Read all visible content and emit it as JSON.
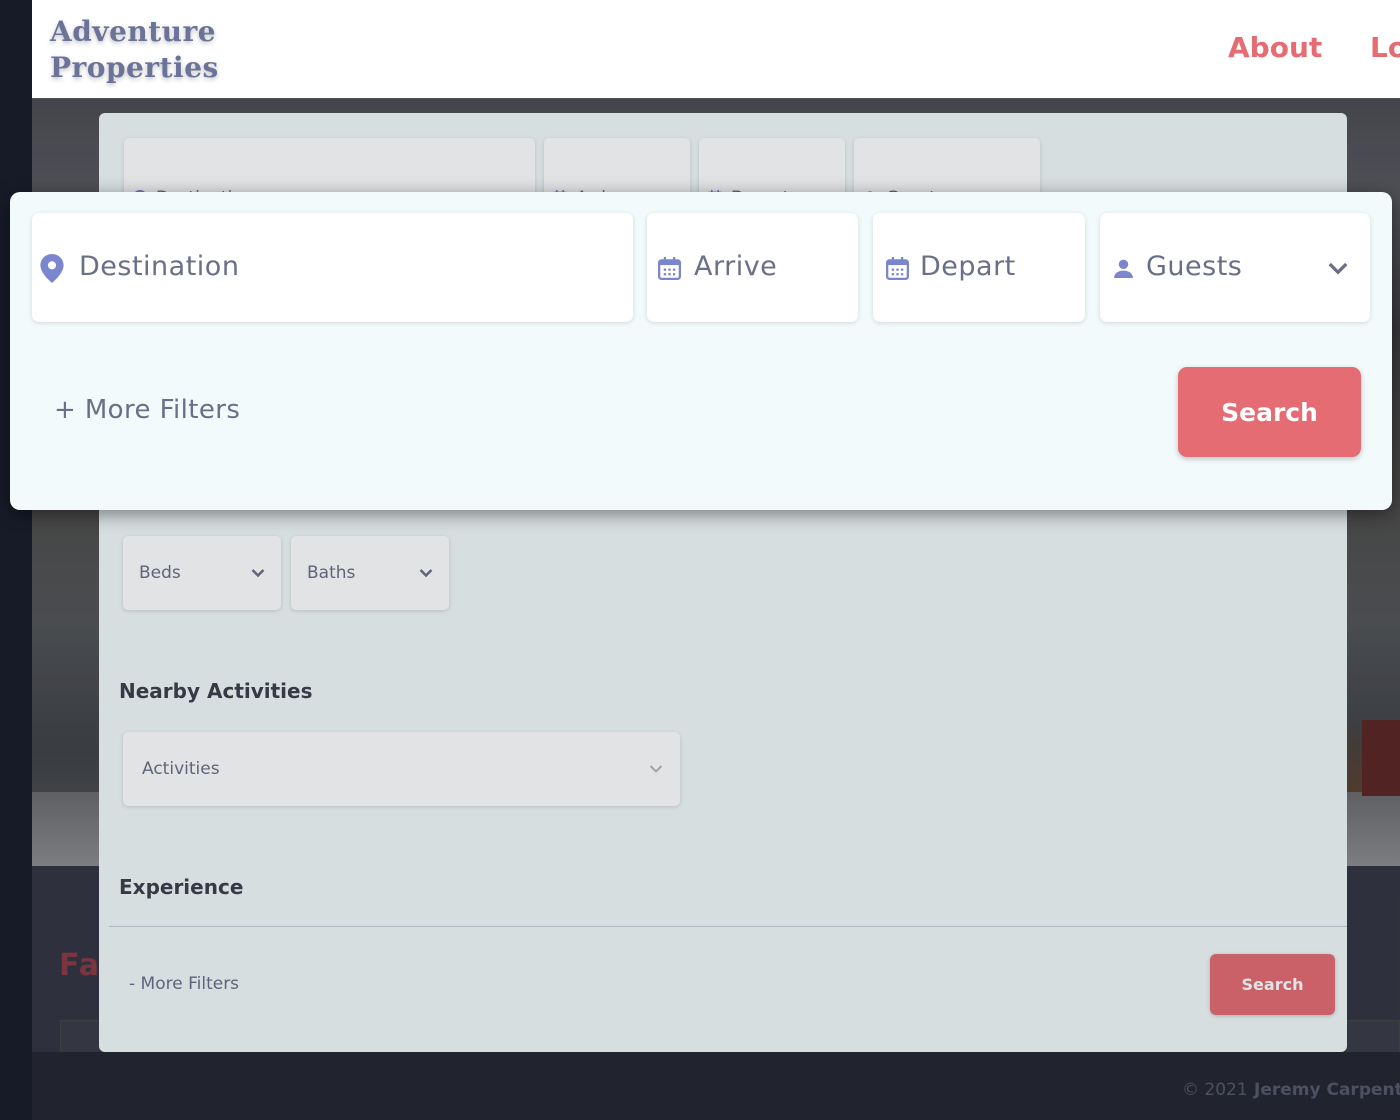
{
  "header": {
    "logo": "Adventure Properties",
    "logo_line1": "Adventure",
    "logo_line2": "Properties",
    "nav": [
      {
        "label": "About"
      },
      {
        "label": "Lo"
      }
    ]
  },
  "search": {
    "destination_placeholder": "Destination",
    "arrive_placeholder": "Arrive",
    "depart_placeholder": "Depart",
    "guests_label": "Guests",
    "more_filters_label": "+ More Filters",
    "less_filters_label": "- More Filters",
    "search_label": "Search",
    "beds_label": "Beds",
    "baths_label": "Baths",
    "nearby_heading": "Nearby Activities",
    "activities_label": "Activities",
    "experience_heading": "Experience"
  },
  "featured": {
    "title": "Fa"
  },
  "footer": {
    "copyright": "© 2021",
    "author": "Jeremy Carpent"
  },
  "colors": {
    "accent": "#e56c72",
    "logo": "#6c7399",
    "icon": "#7b86cf",
    "panel": "#f2fafb",
    "footer": "#242631"
  },
  "icons": [
    "map-pin-icon",
    "calendar-icon",
    "person-icon",
    "chevron-down-icon"
  ]
}
